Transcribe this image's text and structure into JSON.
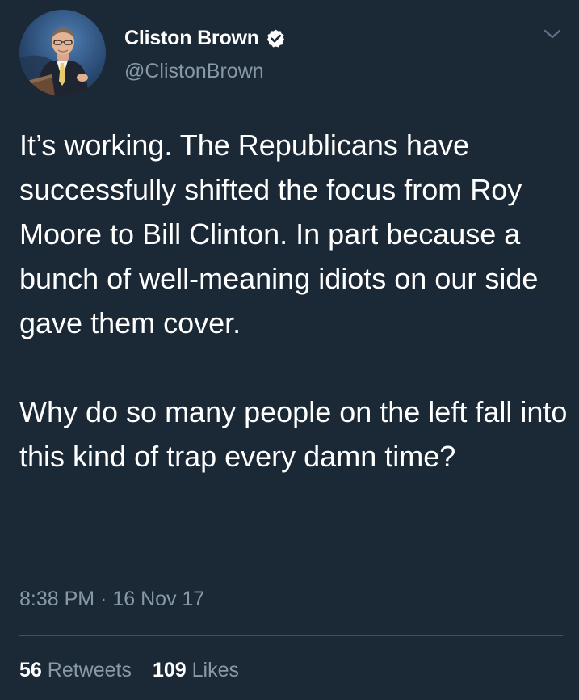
{
  "tweet": {
    "author": {
      "display_name": "Cliston Brown",
      "handle": "@ClistonBrown",
      "verified": true
    },
    "text": {
      "paragraph_1": "It’s working. The Republicans have successfully shifted the focus from Roy Moore to Bill Clinton. In part because a bunch of well-meaning idiots on our side gave them cover.",
      "paragraph_2": "Why do so many people on the left fall into this kind of trap every damn time?"
    },
    "timestamp": "8:38 PM · 16 Nov 17",
    "stats": {
      "retweets_count": "56",
      "retweets_label": "Retweets",
      "likes_count": "109",
      "likes_label": "Likes"
    }
  },
  "theme": {
    "background": "#1b2836",
    "text_primary": "#ffffff",
    "text_secondary": "#8899a6",
    "verified_badge": "#ffffff"
  },
  "icons": {
    "verified": "verified-badge-icon",
    "menu": "chevron-down-icon"
  }
}
